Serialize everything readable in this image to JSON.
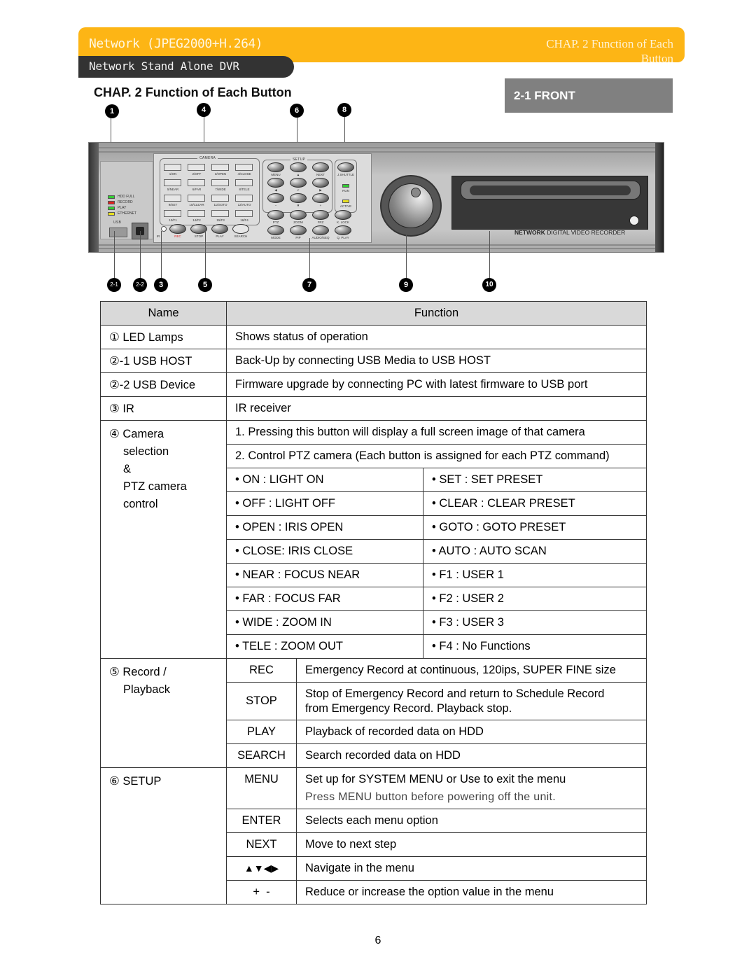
{
  "header": {
    "product": "Network (JPEG2000+H.264)",
    "subtitle": "Network Stand Alone DVR",
    "chapter_line1": "CHAP. 2   Function of Each",
    "chapter_line2": "Button",
    "accent_color": "#fdb515"
  },
  "page": {
    "title": "CHAP. 2  Function of Each Button",
    "section": "2-1 FRONT",
    "number": "6"
  },
  "callouts": {
    "top": [
      "1",
      "4",
      "6",
      "8"
    ],
    "bottom": [
      "2-1",
      "2-2",
      "3",
      "5",
      "7",
      "9",
      "10"
    ]
  },
  "device": {
    "leds": [
      {
        "label": "HDD FULL",
        "color": "#33cc33"
      },
      {
        "label": "RECORD",
        "color": "#e02020"
      },
      {
        "label": "PLAY",
        "color": "#33cc33"
      },
      {
        "label": "ETHERNET",
        "color": "#e8e020"
      }
    ],
    "usb_label": "USB",
    "camera_label": "CAMERA",
    "camera_buttons": [
      "1/ON",
      "2/OFF",
      "3/OPEN",
      "4/CLOSE",
      "5/NEAR",
      "6/FAR",
      "7/WIDE",
      "8/TELE",
      "9/SET",
      "10/CLEAR",
      "11/GOTO",
      "12/AUTO",
      "13/F1",
      "14/F2",
      "15/F3",
      "16/F4"
    ],
    "ir_label": "IR",
    "record_buttons": [
      "REC",
      "STOP",
      "PLAY",
      "SEARCH"
    ],
    "setup_label": "SETUP",
    "setup_buttons": [
      "MENU",
      "▲",
      "NEXT",
      "◀",
      "↵",
      "▶",
      "−",
      "▼",
      "+"
    ],
    "func_buttons": [
      "PTZ",
      "ZOOM",
      "FRZ",
      "K. LOCK",
      "MODE",
      "PIP",
      "AUDIO/SEQ",
      "Q. PLAY"
    ],
    "shuttle_label": "J.SHUTTLE",
    "run_label": "RUN",
    "active_label": "ACTIVE",
    "brand_bold": "NETWORK",
    "brand_rest": " DIGITAL VIDEO RECORDER"
  },
  "table": {
    "headers": [
      "Name",
      "Function"
    ],
    "simple_rows": [
      {
        "name": "① LED Lamps",
        "function": "Shows status of operation"
      },
      {
        "name": "②-1 USB HOST",
        "function": "Back-Up by connecting USB Media to USB HOST"
      },
      {
        "name": "②-2 USB Device",
        "function": "Firmware upgrade by connecting PC with latest firmware to USB port"
      },
      {
        "name": "③ IR",
        "function": "IR receiver"
      }
    ],
    "camera": {
      "name_lines": [
        "④ Camera",
        "selection",
        "&",
        "PTZ camera",
        "control"
      ],
      "line1": "1. Pressing this button will display a full screen image of that camera",
      "line2": "2. Control PTZ camera (Each button is assigned for each PTZ command)",
      "pairs": [
        [
          "• ON : LIGHT ON",
          "• SET : SET PRESET"
        ],
        [
          "• OFF : LIGHT OFF",
          "• CLEAR : CLEAR PRESET"
        ],
        [
          "• OPEN : IRIS OPEN",
          "• GOTO : GOTO PRESET"
        ],
        [
          "• CLOSE: IRIS CLOSE",
          "• AUTO : AUTO SCAN"
        ],
        [
          "• NEAR : FOCUS NEAR",
          "• F1 : USER 1"
        ],
        [
          "• FAR : FOCUS FAR",
          "• F2 : USER 2"
        ],
        [
          "• WIDE : ZOOM IN",
          "• F3 : USER 3"
        ],
        [
          "• TELE : ZOOM OUT",
          "• F4 : No Functions"
        ]
      ]
    },
    "record": {
      "name_lines": [
        "⑤ Record /",
        "Playback"
      ],
      "rows": [
        {
          "key": "REC",
          "function": "Emergency Record at continuous, 120ips, SUPER FINE size"
        },
        {
          "key": "STOP",
          "function": "Stop of Emergency Record and return to Schedule Record",
          "function2": "from Emergency Record. Playback stop."
        },
        {
          "key": "PLAY",
          "function": "Playback of recorded data on HDD"
        },
        {
          "key": "SEARCH",
          "function": "Search recorded data on HDD"
        }
      ]
    },
    "setup": {
      "name": "⑥ SETUP",
      "rows": [
        {
          "key": "MENU",
          "function": "Set up for SYSTEM MENU or Use to exit the menu",
          "note": "Press MENU button before powering off the unit."
        },
        {
          "key": "ENTER",
          "function": "Selects each menu option"
        },
        {
          "key": "NEXT",
          "function": "Move to next step"
        },
        {
          "key": "▲▼◀▶",
          "function": "Navigate in the menu"
        },
        {
          "key": "+  -",
          "function": "Reduce or increase the option value in the menu"
        }
      ]
    }
  }
}
